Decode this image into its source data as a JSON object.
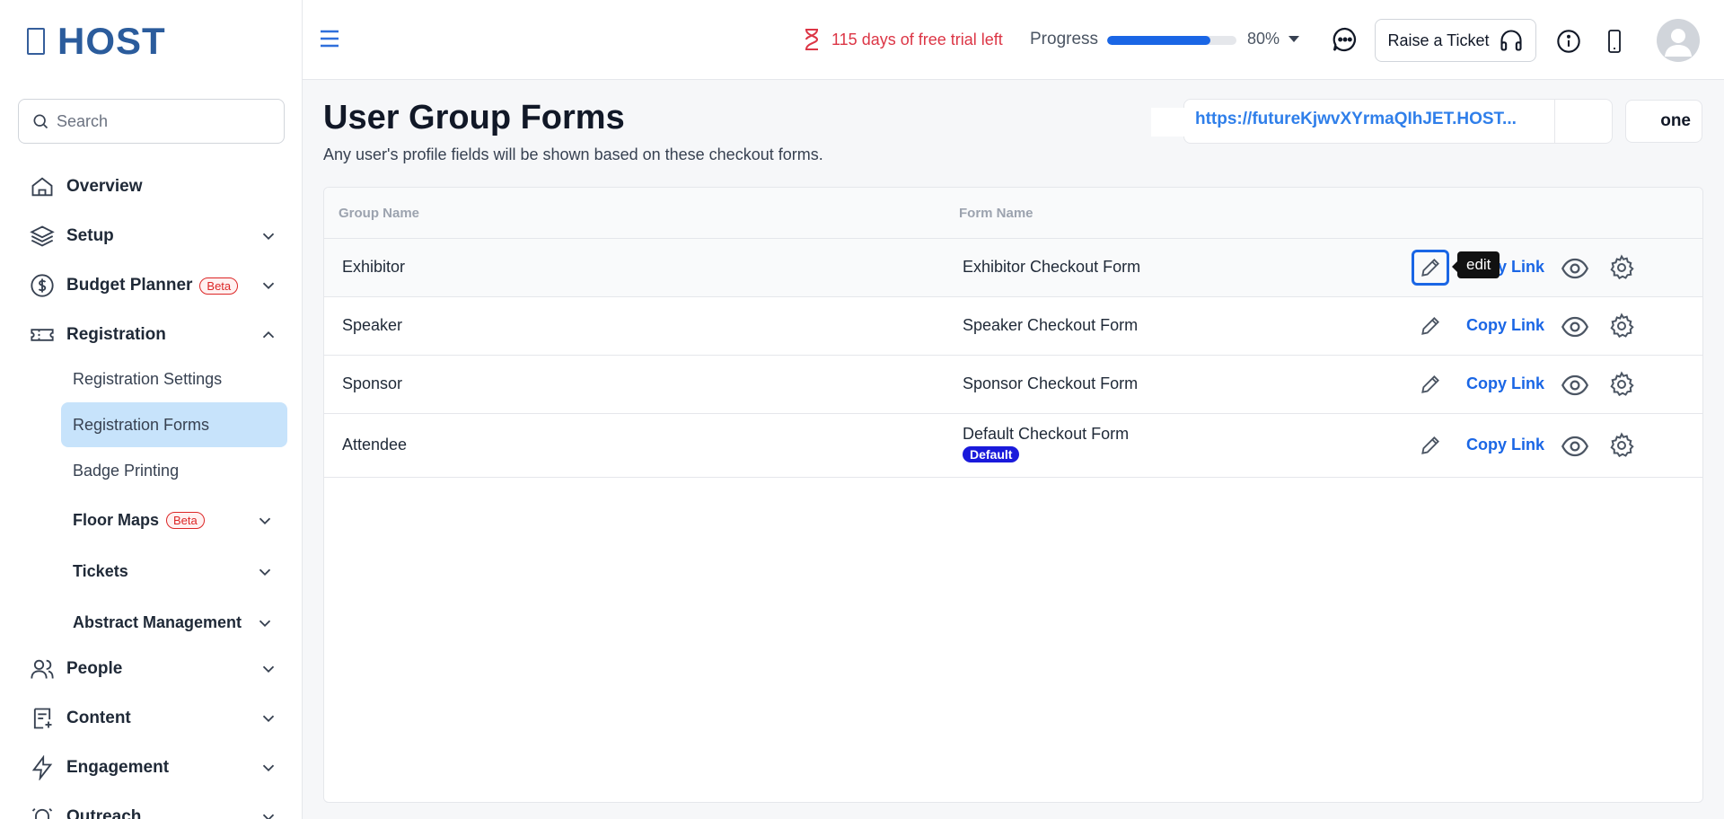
{
  "sidebar": {
    "logo_text": "HOST",
    "search_placeholder": "Search",
    "items": [
      {
        "label": "Overview"
      },
      {
        "label": "Setup"
      },
      {
        "label": "Budget Planner",
        "badge": "Beta"
      },
      {
        "label": "Registration"
      },
      {
        "label": "People"
      },
      {
        "label": "Content"
      },
      {
        "label": "Engagement"
      },
      {
        "label": "Outreach"
      }
    ],
    "registration_sub": [
      {
        "label": "Registration Settings"
      },
      {
        "label": "Registration Forms",
        "active": true
      },
      {
        "label": "Badge Printing"
      },
      {
        "label": "Floor Maps",
        "badge": "Beta"
      },
      {
        "label": "Tickets"
      },
      {
        "label": "Abstract Management"
      }
    ]
  },
  "topbar": {
    "trial_text": "115 days of free trial left",
    "progress_label": "Progress",
    "progress_value": 80,
    "progress_text": "80%",
    "ticket_label": "Raise a Ticket"
  },
  "main": {
    "title": "User Group Forms",
    "subtitle": "Any user's profile fields will be shown based on these checkout forms.",
    "url_text": "https://futureKjwvXYrmaQIhJET.HOST...",
    "done_label": "one"
  },
  "table": {
    "headers": [
      "Group Name",
      "Form Name"
    ],
    "rows": [
      {
        "group": "Exhibitor",
        "form": "Exhibitor Checkout Form",
        "copy": "Copy Link"
      },
      {
        "group": "Speaker",
        "form": "Speaker Checkout Form",
        "copy": "Copy Link"
      },
      {
        "group": "Sponsor",
        "form": "Sponsor Checkout Form",
        "copy": "Copy Link"
      },
      {
        "group": "Attendee",
        "form": "Default Checkout Form",
        "badge": "Default",
        "copy": "Copy Link"
      }
    ],
    "tooltip": "edit"
  },
  "colors": {
    "accent": "#1a66e5",
    "logo": "#2b5c9c",
    "trial": "#dc3545",
    "active_bg": "#c7e3fb",
    "badge_bg": "#1a1adb"
  }
}
